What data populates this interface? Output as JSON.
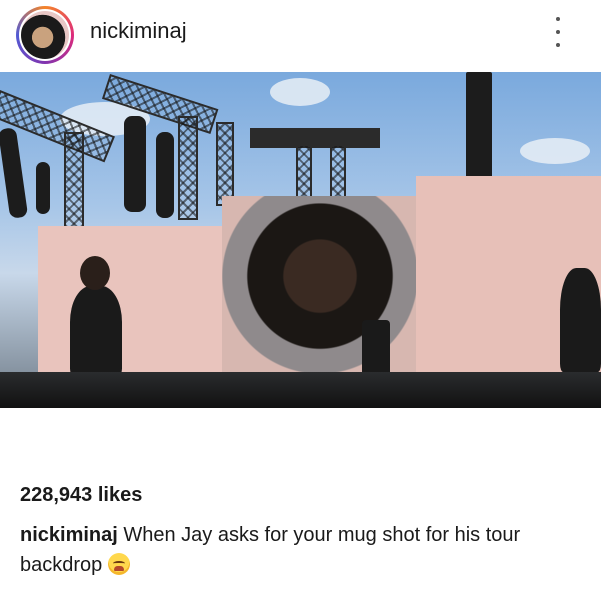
{
  "post": {
    "username": "nickiminaj",
    "likes": "228,943 likes",
    "caption_user": "nickiminaj",
    "caption_text": "When Jay asks for your mug shot for his tour backdrop"
  },
  "icons": {
    "more": "more-options-icon",
    "emoji": "grimacing-face-emoji"
  }
}
